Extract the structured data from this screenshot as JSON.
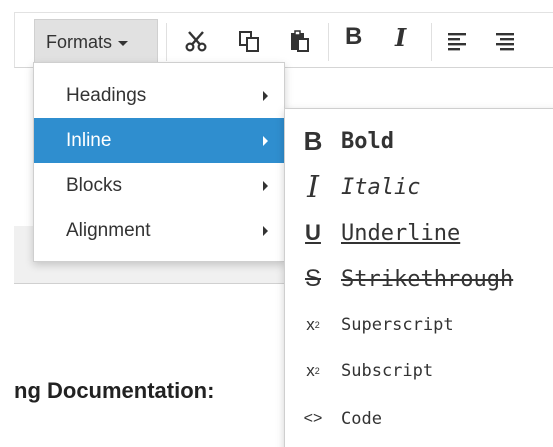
{
  "toolbar": {
    "formats_label": "Formats",
    "buttons": [
      {
        "name": "cut",
        "icon": "scissors-icon"
      },
      {
        "name": "copy",
        "icon": "copy-icon"
      },
      {
        "name": "paste",
        "icon": "paste-icon"
      },
      {
        "name": "bold",
        "icon": "bold-icon",
        "text": "B"
      },
      {
        "name": "italic",
        "icon": "italic-icon",
        "text": "I"
      },
      {
        "name": "align-left",
        "icon": "align-left-icon"
      },
      {
        "name": "align-center",
        "icon": "align-center-icon"
      }
    ]
  },
  "menu": {
    "items": [
      {
        "label": "Headings",
        "active": false
      },
      {
        "label": "Inline",
        "active": true
      },
      {
        "label": "Blocks",
        "active": false
      },
      {
        "label": "Alignment",
        "active": false
      }
    ]
  },
  "submenu": {
    "items": [
      {
        "icon": "B",
        "label": "Bold"
      },
      {
        "icon": "I",
        "label": "Italic"
      },
      {
        "icon": "U",
        "label": "Underline"
      },
      {
        "icon": "S",
        "label": "Strikethrough"
      },
      {
        "icon": "x",
        "label": "Superscript"
      },
      {
        "icon": "x",
        "label": "Subscript"
      },
      {
        "icon": "<>",
        "label": "Code"
      }
    ]
  },
  "editor": {
    "heading_fragment": "ng Documentation:"
  },
  "colors": {
    "active_item_bg": "#2f8ecf",
    "formats_button_bg": "#e1e1e1"
  }
}
